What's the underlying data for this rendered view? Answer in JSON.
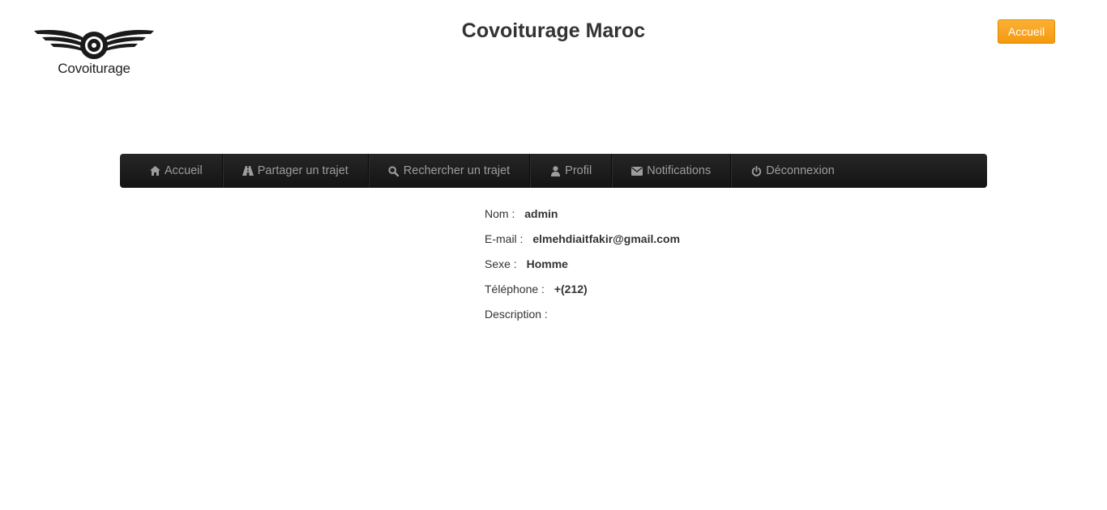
{
  "header": {
    "logo_text": "Covoiturage",
    "title": "Covoiturage Maroc",
    "home_button": "Accueil"
  },
  "colors": {
    "accent": "#f7a11a",
    "navbar": "#1c1c1c",
    "nav_text": "#9d9d9d"
  },
  "nav": {
    "items": [
      {
        "label": "Accueil",
        "icon": "home-icon"
      },
      {
        "label": "Partager un trajet",
        "icon": "road-icon"
      },
      {
        "label": "Rechercher un trajet",
        "icon": "search-icon"
      },
      {
        "label": "Profil",
        "icon": "user-icon"
      },
      {
        "label": "Notifications",
        "icon": "envelope-icon"
      },
      {
        "label": "Déconnexion",
        "icon": "power-icon"
      }
    ]
  },
  "profile": {
    "name_label": "Nom :",
    "name_value": "admin",
    "email_label": "E-mail :",
    "email_value": "elmehdiaitfakir@gmail.com",
    "sex_label": "Sexe :",
    "sex_value": "Homme",
    "phone_label": "Téléphone :",
    "phone_value": "+(212)",
    "description_label": "Description :",
    "description_value": ""
  }
}
